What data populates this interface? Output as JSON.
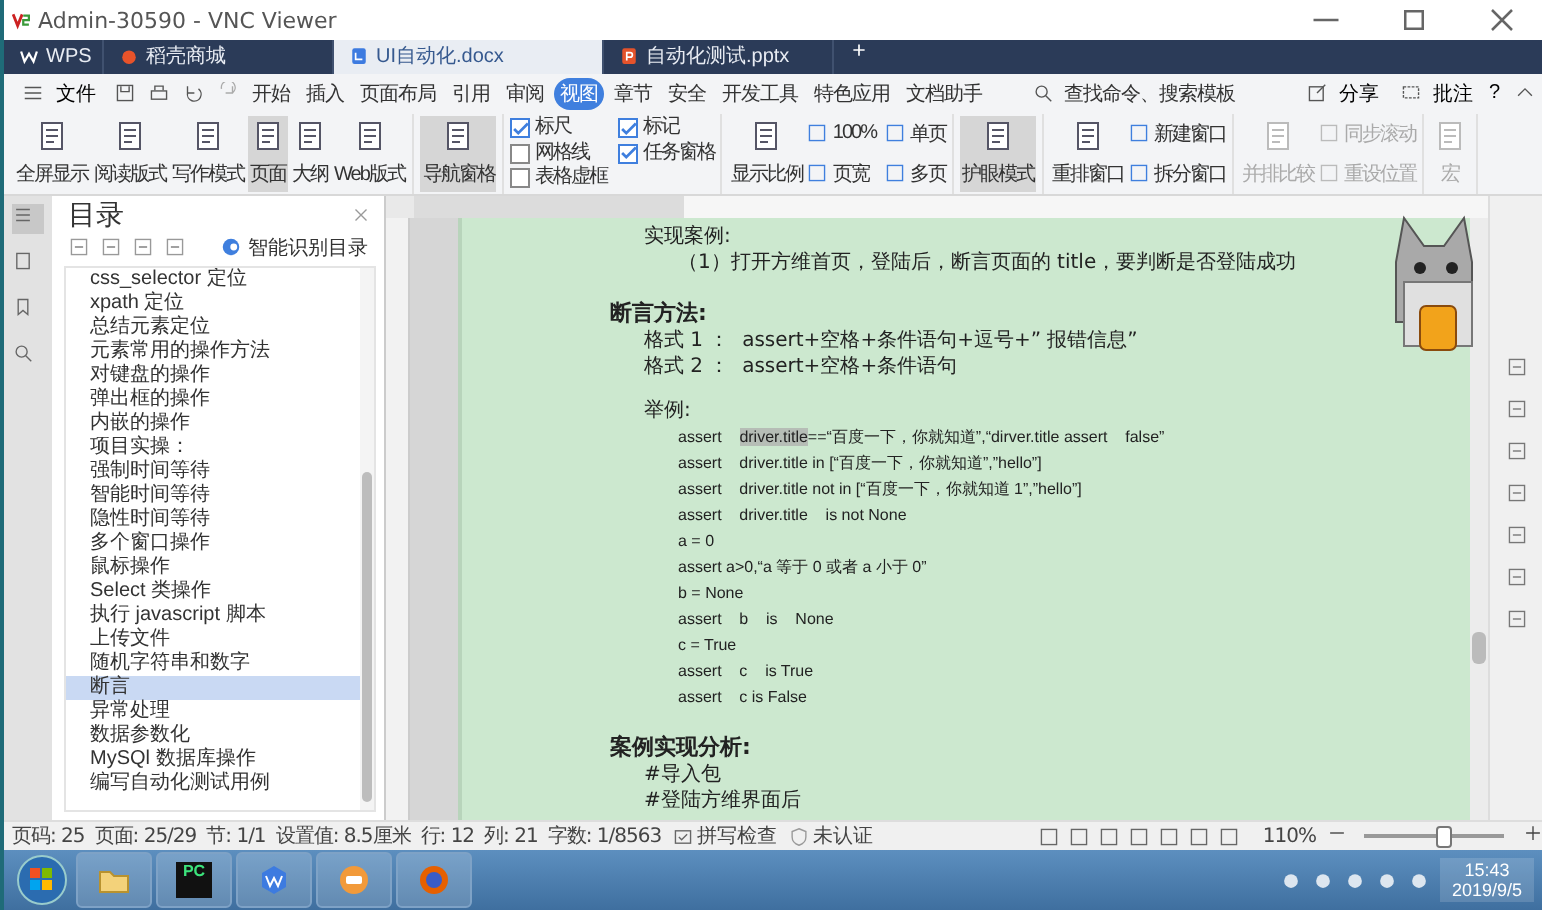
{
  "window": {
    "title": "Admin-30590 - VNC Viewer"
  },
  "tabs": [
    {
      "label": "WPS",
      "kind": "home",
      "selected": false
    },
    {
      "label": "稻壳商城",
      "kind": "store",
      "selected": false
    },
    {
      "label": "UI自动化.docx",
      "kind": "doc",
      "selected": true
    },
    {
      "label": "自动化测试.pptx",
      "kind": "ppt",
      "selected": false
    }
  ],
  "menu": {
    "file": "文件",
    "items": [
      {
        "label": "开始",
        "selected": false
      },
      {
        "label": "插入",
        "selected": false
      },
      {
        "label": "页面布局",
        "selected": false
      },
      {
        "label": "引用",
        "selected": false
      },
      {
        "label": "审阅",
        "selected": false
      },
      {
        "label": "视图",
        "selected": true
      },
      {
        "label": "章节",
        "selected": false
      },
      {
        "label": "安全",
        "selected": false
      },
      {
        "label": "开发工具",
        "selected": false
      },
      {
        "label": "特色应用",
        "selected": false
      },
      {
        "label": "文档助手",
        "selected": false
      }
    ],
    "search": "查找命令、搜索模板",
    "share": "分享",
    "comment": "批注",
    "help": "?"
  },
  "ribbon": [
    [
      {
        "kind": "large",
        "label": "全屏显示",
        "selected": false,
        "disabled": false
      },
      {
        "kind": "large",
        "label": "阅读版式",
        "selected": false,
        "disabled": false
      },
      {
        "kind": "large",
        "label": "写作模式",
        "selected": false,
        "disabled": false
      },
      {
        "kind": "large",
        "label": "页面",
        "selected": true,
        "disabled": false
      },
      {
        "kind": "large",
        "label": "大纲",
        "selected": false,
        "disabled": false
      },
      {
        "kind": "large",
        "label": "Web版式",
        "selected": false,
        "disabled": false
      }
    ],
    [
      {
        "kind": "large",
        "label": "导航窗格",
        "selected": true,
        "disabled": false
      }
    ],
    [
      {
        "kind": "check",
        "label": "标尺",
        "checked": true
      },
      {
        "kind": "check",
        "label": "网格线",
        "checked": false
      },
      {
        "kind": "check",
        "label": "表格虚框",
        "checked": false
      },
      {
        "kind": "check",
        "label": "标记",
        "checked": true
      },
      {
        "kind": "check",
        "label": "任务窗格",
        "checked": true
      }
    ],
    [
      {
        "kind": "large",
        "label": "显示比例",
        "selected": false,
        "disabled": false
      },
      {
        "kind": "small",
        "label": "100%",
        "disabled": false
      },
      {
        "kind": "small",
        "label": "页宽",
        "disabled": false
      },
      {
        "kind": "small",
        "label": "单页",
        "disabled": false
      },
      {
        "kind": "small",
        "label": "多页",
        "disabled": false
      }
    ],
    [
      {
        "kind": "large",
        "label": "护眼模式",
        "selected": true,
        "disabled": false
      }
    ],
    [
      {
        "kind": "large",
        "label": "重排窗口",
        "selected": false,
        "disabled": false
      },
      {
        "kind": "small",
        "label": "新建窗口",
        "disabled": false
      },
      {
        "kind": "small",
        "label": "拆分窗口",
        "disabled": false
      }
    ],
    [
      {
        "kind": "large",
        "label": "并排比较",
        "selected": false,
        "disabled": true
      },
      {
        "kind": "small",
        "label": "同步滚动",
        "disabled": true
      },
      {
        "kind": "small",
        "label": "重设位置",
        "disabled": true
      }
    ],
    [
      {
        "kind": "large",
        "label": "宏",
        "selected": false,
        "disabled": true
      }
    ]
  ],
  "nav": {
    "title": "目录",
    "smart": "智能识别目录",
    "items": [
      {
        "label": "css_selector 定位",
        "selected": false
      },
      {
        "label": "xpath 定位",
        "selected": false
      },
      {
        "label": "总结元素定位",
        "selected": false
      },
      {
        "label": "元素常用的操作方法",
        "selected": false
      },
      {
        "label": "对键盘的操作",
        "selected": false
      },
      {
        "label": "弹出框的操作",
        "selected": false
      },
      {
        "label": "内嵌的操作",
        "selected": false
      },
      {
        "label": "项目实操：",
        "selected": false
      },
      {
        "label": "强制时间等待",
        "selected": false
      },
      {
        "label": "智能时间等待",
        "selected": false
      },
      {
        "label": "隐性时间等待",
        "selected": false
      },
      {
        "label": "多个窗口操作",
        "selected": false
      },
      {
        "label": "鼠标操作",
        "selected": false
      },
      {
        "label": "Select 类操作",
        "selected": false
      },
      {
        "label": "执行 javascript 脚本",
        "selected": false
      },
      {
        "label": "上传文件",
        "selected": false
      },
      {
        "label": "随机字符串和数字",
        "selected": false
      },
      {
        "label": "断言",
        "selected": true
      },
      {
        "label": "异常处理",
        "selected": false
      },
      {
        "label": "数据参数化",
        "selected": false
      },
      {
        "label": "MySQl 数据库操作",
        "selected": false
      },
      {
        "label": "编写自动化测试用例",
        "selected": false
      }
    ]
  },
  "document": [
    {
      "kind": "label",
      "text": "实现案例:"
    },
    {
      "kind": "para",
      "text": "（1）打开方维首页，登陆后，断言页面的 title，要判断是否登陆成功"
    },
    {
      "kind": "heading",
      "text": "断言方法:"
    },
    {
      "kind": "item",
      "text": "格式 1 ：  assert+空格+条件语句+逗号+” 报错信息”"
    },
    {
      "kind": "item",
      "text": "格式 2 ：  assert+空格+条件语句"
    },
    {
      "kind": "label2",
      "text": "举例:"
    },
    {
      "kind": "code",
      "text": "assert    ",
      "marked": "driver.title",
      "after": "==“百度一下，你就知道”,“dirver.title assert    false”"
    },
    {
      "kind": "code",
      "text": "assert    driver.title in [“百度一下，你就知道”,”hello”]"
    },
    {
      "kind": "code",
      "text": "assert    driver.title not in [“百度一下，你就知道 1”,”hello”]"
    },
    {
      "kind": "code",
      "text": "assert    driver.title    is not None"
    },
    {
      "kind": "code",
      "text": "a = 0"
    },
    {
      "kind": "code",
      "text": "assert a>0,“a 等于 0 或者 a 小于 0”"
    },
    {
      "kind": "code",
      "text": "b = None"
    },
    {
      "kind": "code",
      "text": "assert    b    is    None"
    },
    {
      "kind": "code",
      "text": "c = True"
    },
    {
      "kind": "code",
      "text": "assert    c    is True"
    },
    {
      "kind": "code",
      "text": "assert    c is False"
    },
    {
      "kind": "heading",
      "text": "案例实现分析:"
    },
    {
      "kind": "item",
      "text": "#导入包"
    },
    {
      "kind": "item",
      "text": "#登陆方维界面后"
    }
  ],
  "status_bar": {
    "items": [
      "页码: 25",
      "页面: 25/29",
      "节: 1/1",
      "设置值: 8.5厘米",
      "行: 12",
      "列: 21",
      "字数: 1/8563"
    ],
    "spell": "拼写检查",
    "auth": "未认证",
    "zoom": "110%",
    "level": 0.55
  },
  "taskbar": {
    "apps": [
      {
        "kind": "folder"
      },
      {
        "kind": "pycharm",
        "label": "PC"
      },
      {
        "kind": "wps"
      },
      {
        "kind": "chat"
      },
      {
        "kind": "firefox"
      }
    ],
    "time": "15:43",
    "date": "2019/9/5"
  }
}
